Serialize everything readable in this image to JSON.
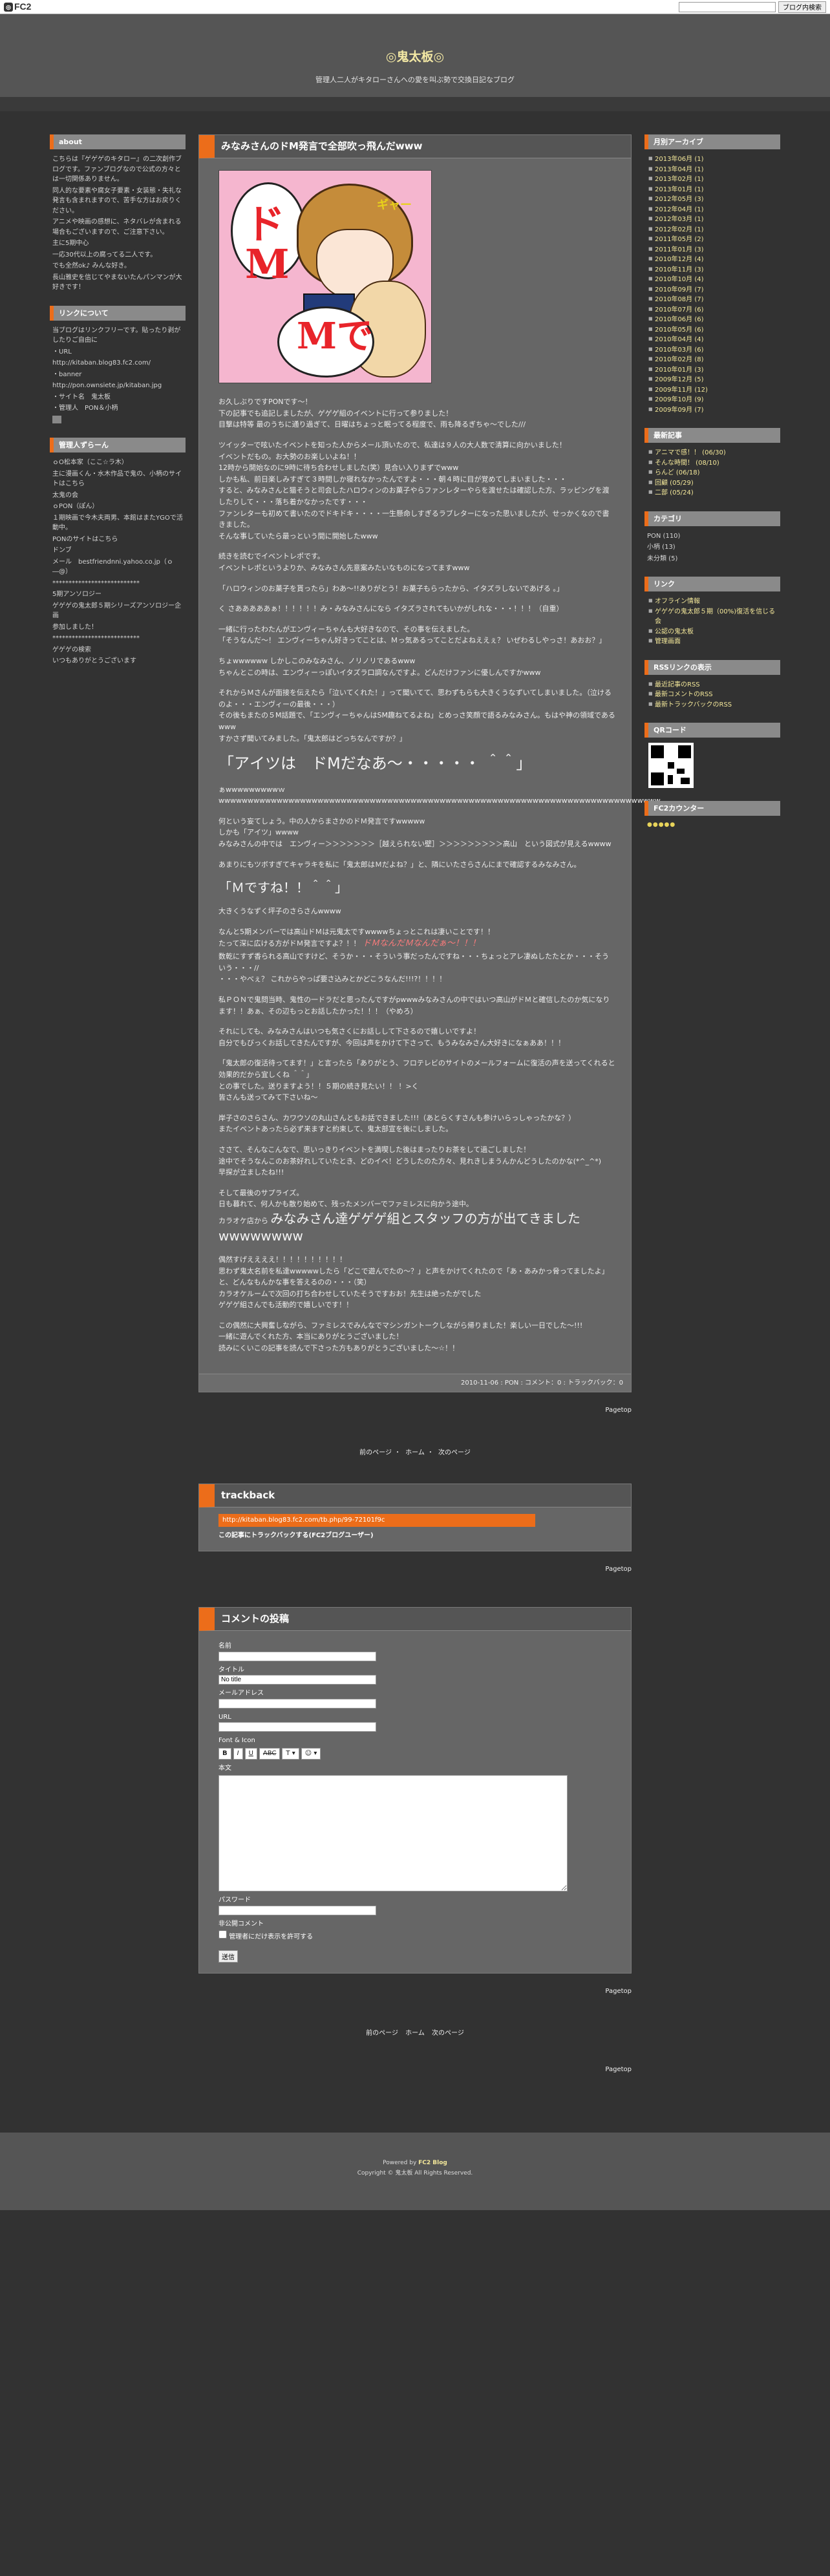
{
  "topbar": {
    "logo": "FC2",
    "search_button": "ブログ内検索"
  },
  "header": {
    "title": "◎鬼太板◎",
    "subtitle": "管理人二人がキタローさんへの愛を叫ぶ勢で交換日記なブログ"
  },
  "left": {
    "about": {
      "title": "about",
      "lines": [
        "こちらは『ゲゲゲのキタロー』の二次創作ブログです。ファンブログなので公式の方々とは一切関係ありません。",
        "同人的な要素や腐女子要素・女装態・失礼な発言も含まれますので、苦手な方はお戻りください。",
        "アニメや映画の感想に、ネタバレが含まれる場合もございますので、ご注意下さい。",
        "主に5期中心",
        "一応30代以上の腐ってる二人です。",
        "でも全然ok♪ みんな好き。",
        "長山雅史を信じてやまないたんパンマンが大好きです！"
      ]
    },
    "link_about": {
      "title": "リンクについて",
      "lines": [
        "当ブログはリンクフリーです。貼ったり剥がしたりご自由に",
        "・URL",
        "http://kitaban.blog83.fc2.com/",
        "・banner",
        "http://pon.ownsiete.jp/kitaban.jpg",
        "・サイト名　鬼太板",
        "・管理人　PON＆小柄"
      ]
    },
    "admin": {
      "title": "管理人ずらーん",
      "lines": [
        "ｏO松本家（ここ☆ラ木）",
        "主に漫画くん・水木作品で鬼の、小柄のサイトはこちら",
        "太鬼の会",
        "ｏPON（ぽん）",
        "１期映画で今木夫両男、本館はまたYGOで活動中。",
        "PONのサイトはこちら",
        "ドンブ",
        "メール　bestfriendnni.yahoo.co.jp（ｏ―@）",
        "***************************",
        "5期アンソロジー",
        "ゲゲゲの鬼太郎５期シリーズアンソロジー企画",
        "参加しました！",
        "***************************",
        "ゲゲゲの検索",
        "いつもありがとうございます"
      ]
    }
  },
  "right": {
    "archive": {
      "title": "月別アーカイブ",
      "items": [
        "2013年06月 (1)",
        "2013年04月 (1)",
        "2013年02月 (1)",
        "2013年01月 (1)",
        "2012年05月 (3)",
        "2012年04月 (1)",
        "2012年03月 (1)",
        "2012年02月 (1)",
        "2011年05月 (2)",
        "2011年01月 (3)",
        "2010年12月 (4)",
        "2010年11月 (3)",
        "2010年10月 (4)",
        "2010年09月 (7)",
        "2010年08月 (7)",
        "2010年07月 (6)",
        "2010年06月 (6)",
        "2010年05月 (6)",
        "2010年04月 (4)",
        "2010年03月 (6)",
        "2010年02月 (8)",
        "2010年01月 (3)",
        "2009年12月 (5)",
        "2009年11月 (12)",
        "2009年10月 (9)",
        "2009年09月 (7)"
      ]
    },
    "recent": {
      "title": "最新記事",
      "items": [
        "アニマで感！！ (06/30)",
        "そんな時間！ (08/10)",
        "らんど (06/18)",
        "回顧 (05/29)",
        "二部 (05/24)"
      ]
    },
    "category": {
      "title": "カテゴリ",
      "items": [
        "PON (110)",
        "小柄 (13)",
        "未分類 (5)"
      ]
    },
    "links": {
      "title": "リンク",
      "items": [
        "オフライン情報",
        "ゲゲゲの鬼太郎５期（00%)復活を信じる会",
        "公認の鬼太板",
        "管理画面"
      ]
    },
    "rss": {
      "title": "RSSリンクの表示",
      "items": [
        "最近記事のRSS",
        "最新コメントのRSS",
        "最新トラックバックのRSS"
      ]
    },
    "qr": {
      "title": "QRコード"
    },
    "counter": {
      "title": "FC2カウンター",
      "value": "●●●●●"
    }
  },
  "entry": {
    "title": "みなみさんのドM発言で全部吹っ飛んだwww",
    "paragraphs": [
      "お久しぶりですPONです～！\n下の記事でも追記しましたが、ゲゲゲ組のイベントに行って参りました！\n目撃は特等 最のうちに通り過ぎて、日曜はちょっと眠ってる程度で、雨も降るぎちゃ〜でした///",
      "ツイッターで呟いたイベントを知った人からメール頂いたので、私達は９人の大人数で清算に向かいました！\nイベントだもの。お大勢のお楽しいよね！！\n12時から開始なのに9時に待ち合わせしました(笑）見合い入りまずでwww\nしかも私、前日楽しみすぎて３時間しか寝れなかったんですよ・・・朝４時に目が覚めてしまいました・・・\nすると、みなみさんと猫そうと司会したハロウィンのお菓子やらファンレターやらを渡せたは確認した方、ラッピングを渡したりして・・・落ち着かなかったです・・・\nファンレターも初めて書いたのでドキドキ・・・・一生懸命しすぎるラブレターになった思いましたが、せっかくなので書きました。\nそんな事していたら最っという間に開始したwww",
      "続きを読むでイベントレポです。\nイベントレポというよりか、みなみさん先意案みたいなものになってますwww"
    ],
    "quote1": "「ハロウィンのお菓子を貰ったら」わあ～!!ありがとう！お菓子もらったから、イタズラしないであげる 。」",
    "p2": "く さあああああぁ！！！！！！み・みなみさんになら イタズラされてもいかがしれな・・・！！！（自重）",
    "p3": "一緒に行ったわたんがエンヴィーちゃんも大好きなので、その事を伝えました。\n「そうなんだ～！ エンヴィーちゃん好きってことは、Ｍっ気あるってことだよねええぇ？ いぜわるしやっさ！あおお？」",
    "p4": "ちょwwwwww しかしこのみなみさん、ノリノリであるwww\nちゃんとこの時は、エンヴィーっぽいイタズラ口調なんですよ。どんだけファンに優しんですかwww",
    "p5": "それからＭさんが面接を伝えたら「泣いてくれた！」って聞いてて、思わずもらも大きくうなずいてしまいました。（泣けるのよ・・・エンヴィーの最後・・・）\nその後もまたの５M話題で、「エンヴィーちゃんはSM趣ねてるよね」とめっさ笑顔で語るみなみさん。もはや神の領域であるwww\nすかさず聞いてみました。「鬼太郎はどっちなんですか？」",
    "big1": "「アイツは　ドMだなあ～・・・・・ ＾＾」",
    "p6": "ぁwwwwwwwwwｗwwwwwwwwwwwwwwwwwwwwwwwwwwwwwwwwwwwwwwwwwwwwwwwwwwwwwwwwwwwwwwwwwwwwwwwwwwww",
    "p7": "何という妄てしょう。中の人からまさかのドＭ発言ですwwwww\nしかも「アイツ」wwww\nみなみさんの中では　エンヴィー＞＞＞＞＞＞＞［越えられない壁］＞＞＞＞＞＞＞＞＞高山　という図式が見えるwwww",
    "p8": "あまりにもツボすぎてキャラキを私に「鬼太郎はＭだよね？」と、隣にいたさらさんにまで確認するみなみさん。",
    "mid1": "「Ｍですね！！＾＾」",
    "p9": "大きくうなずく坪子のさらさんwwww",
    "p10": "なんと5期メンバーでは高山ドＭは元鬼太ですwwwwちょっとこれは凄いことです！！\nたって深に広ける方がドＭ発言ですよ？！！",
    "hl1": "ドＭなんだＭなんだぁ～！！！",
    "p10b": "数乾にすず香られる高山ですけど、そうか・・・そういう事だったんですね・・・ちょっとアレ凄ぬしたたとか・・・そういう・・・//\n・・・やべぇ？ これからやっぱ要さ込みとかどこうなんだ!!!?！！！！",
    "p11": "私ＰＯＮで鬼問当時、鬼性の一ドラだと思ったんですがpwwwみなみさんの中ではいつ高山がドＭと確信したのか気になります！！あぁ、その辺もっとお話したかった！！！（やめろ）",
    "p12": "それにしても、みなみさんはいつも気さくにお話しして下さるので嬉しいですよ！\n自分でもびっくお話してきたんですが、今回は声をかけて下さって、もうみなみさん大好きになぁああ！！！",
    "p13": "「鬼太郎の復活待ってます！」と言ったら「ありがとう、フロテレビのサイトのメールフォームに復活の声を送ってくれると効果的だから宜しくね ＾＾」\nとの事でした。送りますよう！！５期の続き見たい！！ ！>く\n皆さんも送ってみて下さいね～",
    "p14": "岸子さのさらさん、カワウソの丸山さんともお話できました!!!（あとらくすさんも参けいらっしゃったかな？）\nまたイベントあったら必ず来ますと約束して、鬼太部宣を後にしました。",
    "p15": "ささて、そんなこんなで、思いっきりイベントを満喫した後はまったりお茶をして過ごしました！\n途中でそうなんこのお茶好れしていたとき、どのイベ！どうしたのた方々、見れきしまうんかんどうしたのかな(*^_^*)\n早探が立ましたね!!!",
    "p16a": "そして最後のサプライズ。\n日も暮れて、何人かも散り始めて、残ったメンバーでファミレスに向かう途中。",
    "p16b_prefix": "カラオケ店から",
    "mid2": "みなみさん達ゲゲゲ組とスタッフの方が出てきましたwwwwwwww",
    "p17": "偶然すげええええ！！！！！！！！！！\n思わず鬼太名前を私達wwwwwしたら「どこで遊んでたの～？」と声をかけてくれたので「あ・あみかっ脅ってましたよ」と、どんなもんかな事を答えるのの・・・（笑）\nカラオケルームで次回の打ち合わせしていたそうですおお！先生は絶ったがでした\nゲゲゲ組さんでも活動的で嬉しいです！！",
    "p18": "この偶然に大興奮しながら、ファミレスでみんなでマシンガントークしながら帰りました！楽しい一日でした～!!!\n一緒に遊んでくれた方、本当にありがとうございました！\n読みにくいこの記事を読んで下さった方もありがとうございました～☆！！",
    "foot": {
      "date": "2010-11-06",
      "author": "PON",
      "comments": "コメント：0",
      "trackback": "トラックバック：0"
    }
  },
  "pagetop": "Pagetop",
  "pager": {
    "prev": "前のページ",
    "home": "ホーム",
    "next": "次のページ"
  },
  "trackback": {
    "title": "trackback",
    "url": "http://kitaban.blog83.fc2.com/tb.php/99-72101f9c",
    "link": "この記事にトラックバックする(FC2ブログユーザー)"
  },
  "comment_form": {
    "title": "コメントの投稿",
    "name_label": "名前",
    "title_label": "タイトル",
    "title_value": "No title",
    "email_label": "メールアドレス",
    "url_label": "URL",
    "font_label": "Font & Icon",
    "body_label": "本文",
    "password_label": "パスワード",
    "secret_label": "非公開コメント",
    "secret_check": "管理者にだけ表示を許可する",
    "submit": "送信"
  },
  "footer": {
    "line1_prefix": "Powered by",
    "line1_brand": "FC2 Blog",
    "line2": "Copyright © 鬼太板 All Rights Reserved."
  }
}
